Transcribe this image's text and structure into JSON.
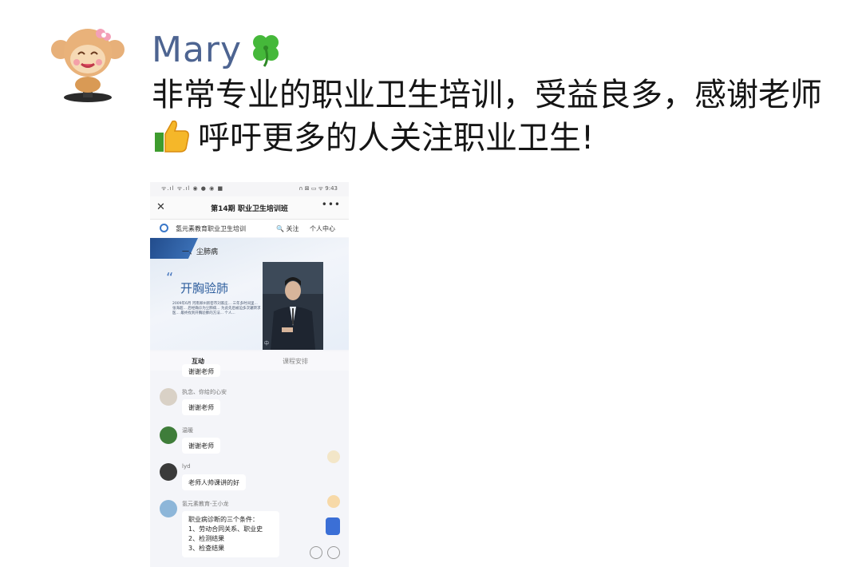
{
  "post": {
    "author": "Mary",
    "text_part1": "非常专业的职业卫生培训，受益良多，感谢老师",
    "text_part2": "呼吁更多的人关注职业卫生!",
    "icons": [
      "monkey-avatar-icon",
      "four-leaf-clover-icon",
      "thumbs-up-icon"
    ]
  },
  "phone": {
    "status": {
      "left": "ᯤ.ıl ᯤ.ıl ◉ ● ◉ ■",
      "right": "∩ ⊠ ▭ ᯤ 9:43"
    },
    "title": "第14期 职业卫生培训班",
    "close": "✕",
    "more": "•••",
    "org_name": "氢元素教育职业卫生培训",
    "follow": "🔍 关注",
    "personal_center": "个人中心",
    "video": {
      "slide_title": "一、尘肺病",
      "heading": "开胸验肺",
      "quote_open": "“",
      "quote_close": "”",
      "paragraph": "2009年6月 河南郑州新密市刘家庄... 三年多时间里... 张海超... 后经确诊为尘肺病... 为此先后被迫多次辗转求医... 最终找到开胸验肺的方法... 个人...",
      "caption": "中"
    },
    "tabs": {
      "interact": "互动",
      "schedule": "课程安排"
    },
    "chat": [
      {
        "name": "",
        "message": "谢谢老师"
      },
      {
        "name": "执念、你给的心安",
        "message": "谢谢老师"
      },
      {
        "name": "温暖",
        "message": "谢谢老师"
      },
      {
        "name": "lyd",
        "message": "老师人帅课讲的好"
      },
      {
        "name": "氢元素教育-王小龙",
        "message_lines": [
          "职业病诊断的三个条件：",
          "1、劳动合同关系、职业史",
          "2、检测结果",
          "3、检查结果"
        ]
      }
    ]
  }
}
